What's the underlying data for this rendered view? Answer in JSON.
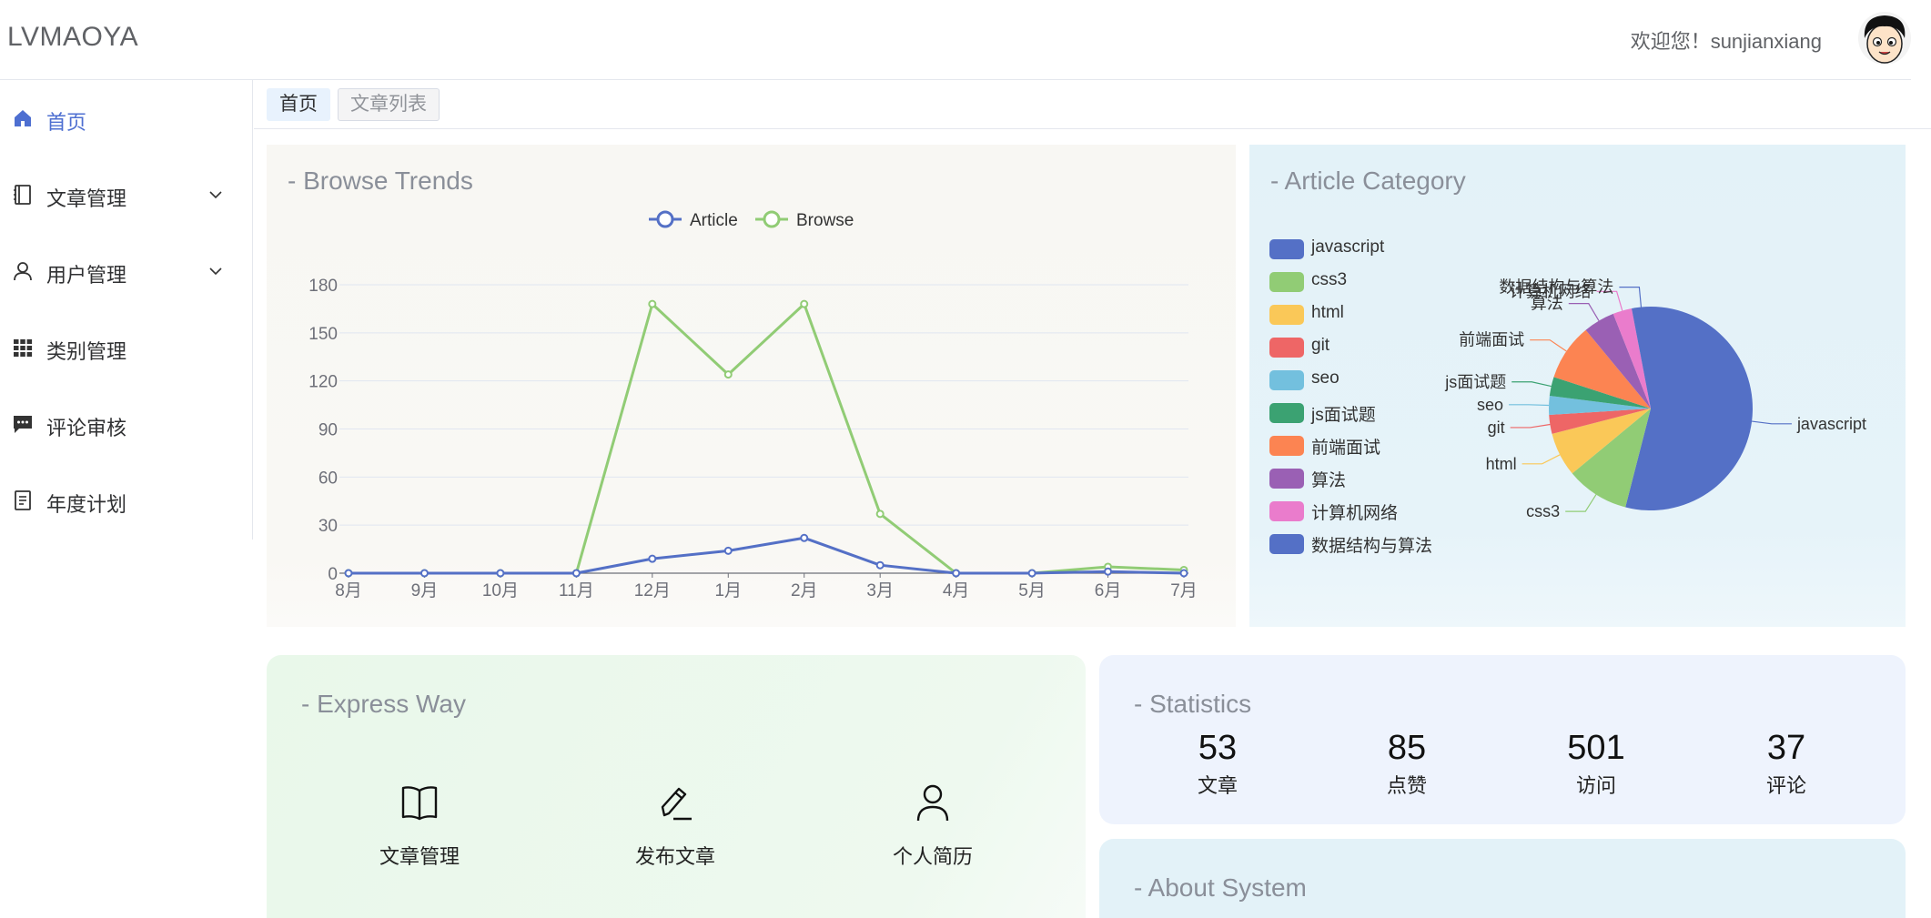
{
  "header": {
    "logo": "LVMAOYA",
    "welcome": "欢迎您！sunjianxiang"
  },
  "sidebar": {
    "items": [
      {
        "label": "首页",
        "icon": "home-icon",
        "active": true
      },
      {
        "label": "文章管理",
        "icon": "notebook-icon",
        "expandable": true
      },
      {
        "label": "用户管理",
        "icon": "user-icon",
        "expandable": true
      },
      {
        "label": "类别管理",
        "icon": "grid-icon"
      },
      {
        "label": "评论审核",
        "icon": "comment-icon"
      },
      {
        "label": "年度计划",
        "icon": "document-icon"
      }
    ]
  },
  "tabs": [
    {
      "label": "首页",
      "active": true
    },
    {
      "label": "文章列表",
      "active": false
    }
  ],
  "browse_card": {
    "title": "- Browse Trends"
  },
  "category_card": {
    "title": "- Article Category"
  },
  "chart_data": [
    {
      "type": "line",
      "categories": [
        "8月",
        "9月",
        "10月",
        "11月",
        "12月",
        "1月",
        "2月",
        "3月",
        "4月",
        "5月",
        "6月",
        "7月"
      ],
      "series": [
        {
          "name": "Article",
          "color": "#5470c6",
          "values": [
            0,
            0,
            0,
            0,
            9,
            14,
            22,
            5,
            0,
            0,
            1,
            0
          ]
        },
        {
          "name": "Browse",
          "color": "#91cc75",
          "values": [
            0,
            0,
            0,
            0,
            168,
            124,
            168,
            37,
            0,
            0,
            4,
            2
          ]
        }
      ],
      "y_ticks": [
        0,
        30,
        60,
        90,
        120,
        150,
        180
      ],
      "ylim": [
        0,
        180
      ],
      "legend": "top-center",
      "grid": true
    },
    {
      "type": "pie",
      "legend": "left",
      "slices": [
        {
          "name": "javascript",
          "value": 54,
          "color": "#5470c6"
        },
        {
          "name": "css3",
          "value": 10,
          "color": "#91cc75"
        },
        {
          "name": "html",
          "value": 7,
          "color": "#fac858"
        },
        {
          "name": "git",
          "value": 3,
          "color": "#ee6666"
        },
        {
          "name": "seo",
          "value": 3,
          "color": "#73c0de"
        },
        {
          "name": "js面试题",
          "value": 3,
          "color": "#3ba272"
        },
        {
          "name": "前端面试",
          "value": 9,
          "color": "#fc8452"
        },
        {
          "name": "算法",
          "value": 5,
          "color": "#9a60b4"
        },
        {
          "name": "计算机网络",
          "value": 3,
          "color": "#ea7ccc"
        },
        {
          "name": "数据结构与算法",
          "value": 3,
          "color": "#5470c6"
        }
      ]
    }
  ],
  "express": {
    "title": "- Express Way",
    "items": [
      {
        "label": "文章管理",
        "icon": "book-icon"
      },
      {
        "label": "发布文章",
        "icon": "pen-icon"
      },
      {
        "label": "个人简历",
        "icon": "person-icon"
      }
    ]
  },
  "statistics": {
    "title": "- Statistics",
    "items": [
      {
        "value": "53",
        "label": "文章"
      },
      {
        "value": "85",
        "label": "点赞"
      },
      {
        "value": "501",
        "label": "访问"
      },
      {
        "value": "37",
        "label": "评论"
      }
    ]
  },
  "about": {
    "title": "- About System"
  }
}
